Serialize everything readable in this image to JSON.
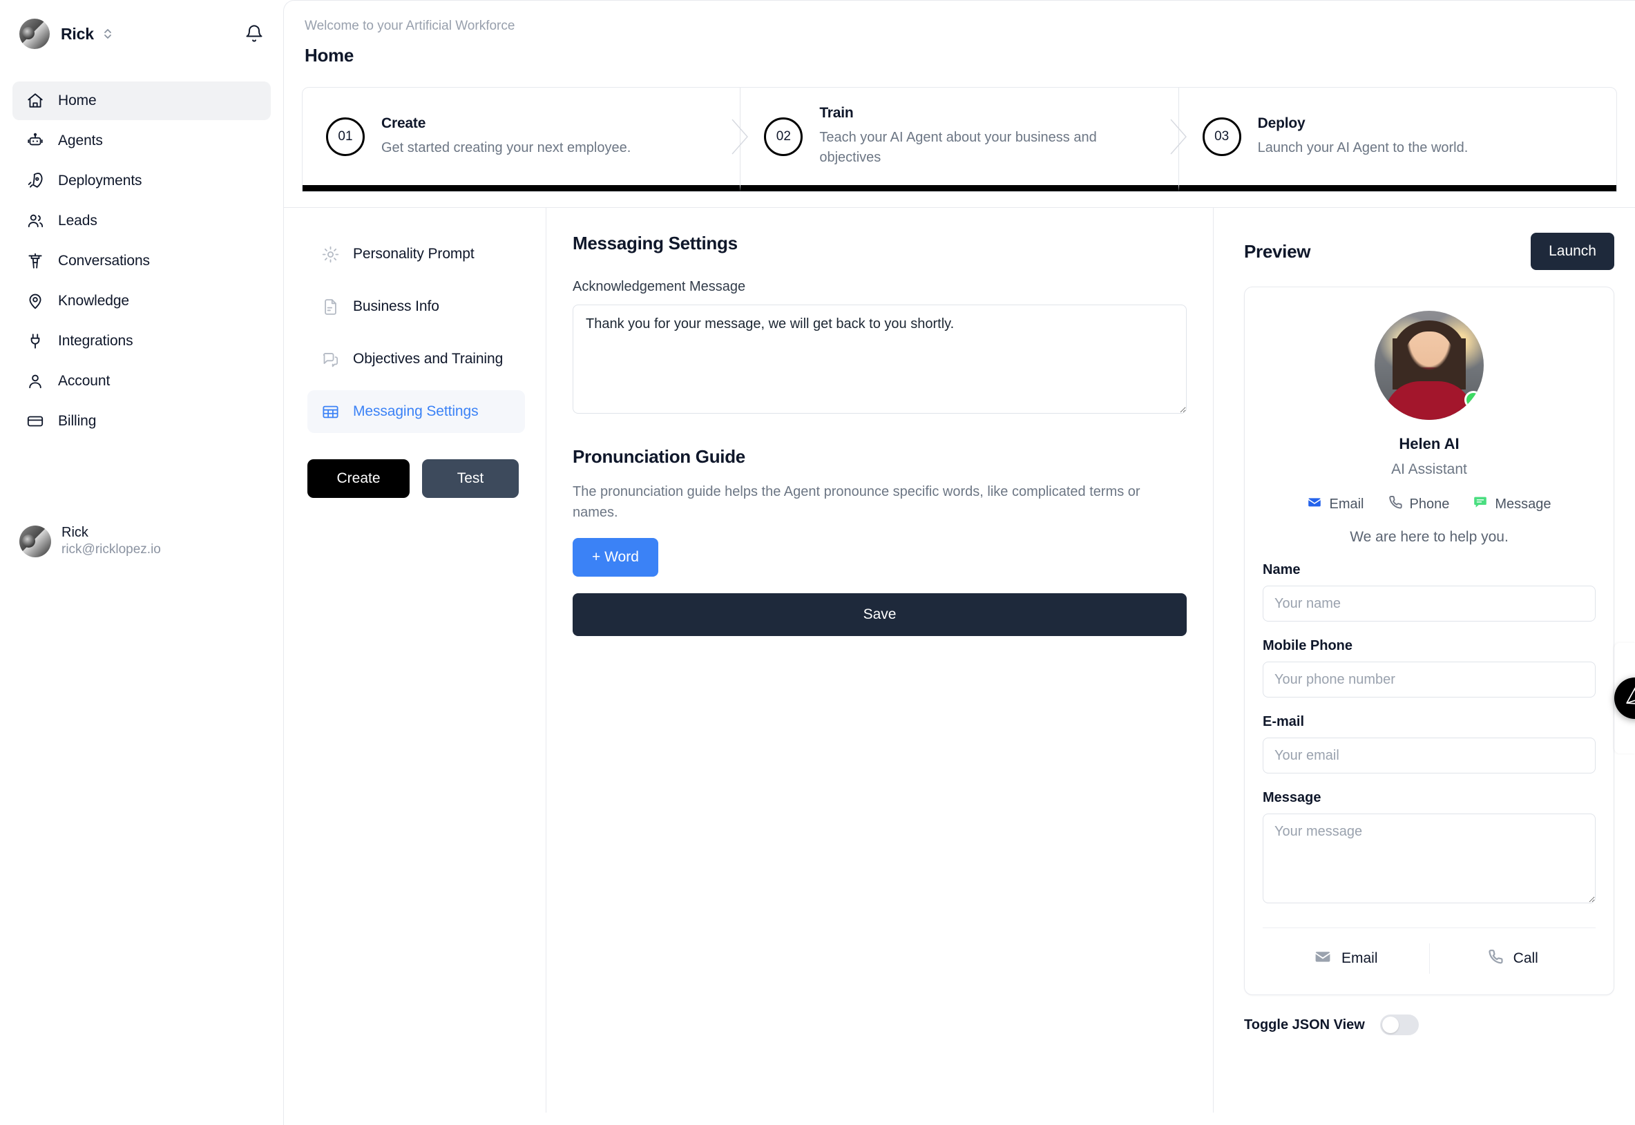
{
  "sidebar": {
    "account_name": "Rick",
    "switcher_icon": "chevron-up-down-icon",
    "bell_icon": "bell-icon",
    "items": [
      {
        "label": "Home",
        "icon": "home-icon",
        "active": true
      },
      {
        "label": "Agents",
        "icon": "robot-icon",
        "active": false
      },
      {
        "label": "Deployments",
        "icon": "rocket-icon",
        "active": false
      },
      {
        "label": "Leads",
        "icon": "users-icon",
        "active": false
      },
      {
        "label": "Conversations",
        "icon": "control-tower-icon",
        "active": false
      },
      {
        "label": "Knowledge",
        "icon": "map-pin-icon",
        "active": false
      },
      {
        "label": "Integrations",
        "icon": "plug-icon",
        "active": false
      },
      {
        "label": "Account",
        "icon": "user-icon",
        "active": false
      },
      {
        "label": "Billing",
        "icon": "credit-card-icon",
        "active": false
      }
    ],
    "user": {
      "name": "Rick",
      "email": "rick@ricklopez.io"
    }
  },
  "header": {
    "welcome": "Welcome to your Artificial Workforce",
    "title": "Home"
  },
  "stepper": {
    "steps": [
      {
        "num": "01",
        "title": "Create",
        "desc": "Get started creating your next employee."
      },
      {
        "num": "02",
        "title": "Train",
        "desc": "Teach your AI Agent about your business and objectives"
      },
      {
        "num": "03",
        "title": "Deploy",
        "desc": "Launch your AI Agent to the world."
      }
    ]
  },
  "tabs": {
    "items": [
      {
        "label": "Personality Prompt",
        "icon": "gear-icon",
        "active": false
      },
      {
        "label": "Business Info",
        "icon": "document-icon",
        "active": false
      },
      {
        "label": "Objectives and Training",
        "icon": "chat-bubbles-icon",
        "active": false
      },
      {
        "label": "Messaging Settings",
        "icon": "table-icon",
        "active": true
      }
    ],
    "create_label": "Create",
    "test_label": "Test"
  },
  "form": {
    "section_title": "Messaging Settings",
    "ack_label": "Acknowledgement Message",
    "ack_value": "Thank you for your message, we will get back to you shortly.",
    "pron_title": "Pronunciation Guide",
    "pron_help": "The pronunciation guide helps the Agent pronounce specific words, like complicated terms or names.",
    "add_word_label": "+ Word",
    "save_label": "Save"
  },
  "preview": {
    "title": "Preview",
    "launch_label": "Launch",
    "agent_name": "Helen AI",
    "agent_role": "AI Assistant",
    "status": "online",
    "channels": [
      {
        "label": "Email",
        "icon": "envelope-icon",
        "color": "#2563eb"
      },
      {
        "label": "Phone",
        "icon": "phone-icon",
        "color": "#6b7280"
      },
      {
        "label": "Message",
        "icon": "chat-bubble-icon",
        "color": "#4ade80"
      }
    ],
    "tagline": "We are here to help you.",
    "fields": [
      {
        "label": "Name",
        "placeholder": "Your name",
        "value": "",
        "type": "input"
      },
      {
        "label": "Mobile Phone",
        "placeholder": "Your phone number",
        "value": "",
        "type": "input"
      },
      {
        "label": "E-mail",
        "placeholder": "Your email",
        "value": "",
        "type": "input"
      },
      {
        "label": "Message",
        "placeholder": "Your message",
        "value": "",
        "type": "textarea"
      }
    ],
    "actions": [
      {
        "label": "Email",
        "icon": "envelope-icon"
      },
      {
        "label": "Call",
        "icon": "phone-icon"
      }
    ],
    "json_toggle_label": "Toggle JSON View",
    "json_toggle_on": false
  },
  "fab": {
    "icon": "prism-logo-icon"
  },
  "colors": {
    "accent_blue": "#3b82f6",
    "dark_navy": "#1e293b",
    "black": "#000000",
    "status_green": "#3ddb63",
    "muted_text": "#6c7684"
  }
}
